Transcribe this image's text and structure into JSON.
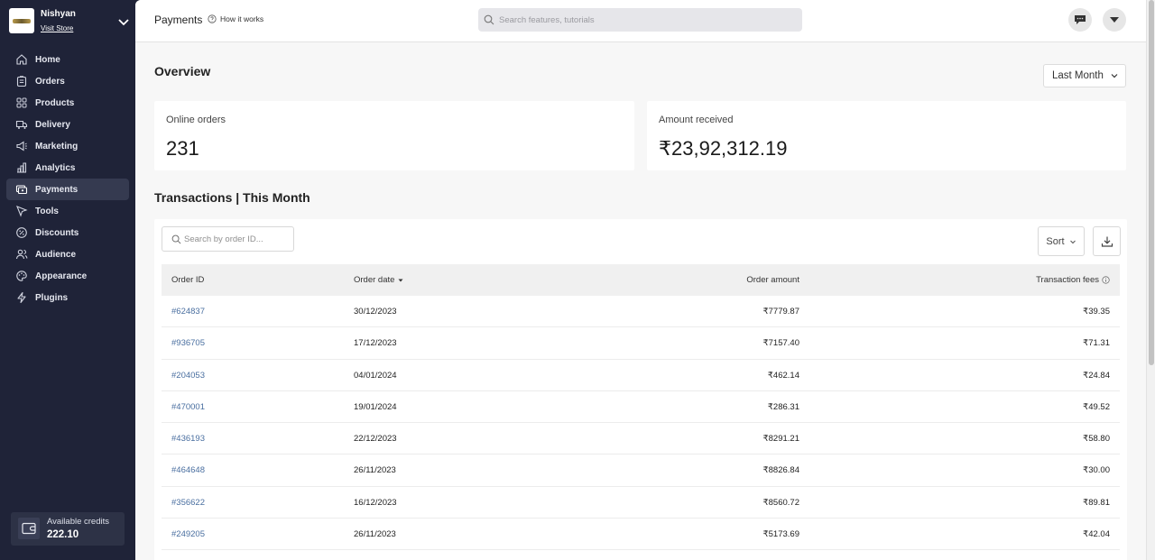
{
  "store": {
    "name": "Nishyan",
    "visit_label": "Visit Store"
  },
  "sidebar": {
    "items": [
      {
        "label": "Home",
        "icon": "home-icon"
      },
      {
        "label": "Orders",
        "icon": "clipboard-icon"
      },
      {
        "label": "Products",
        "icon": "grid-icon"
      },
      {
        "label": "Delivery",
        "icon": "truck-icon"
      },
      {
        "label": "Marketing",
        "icon": "megaphone-icon"
      },
      {
        "label": "Analytics",
        "icon": "bar-chart-icon"
      },
      {
        "label": "Payments",
        "icon": "payments-icon",
        "active": true
      },
      {
        "label": "Tools",
        "icon": "cursor-icon"
      },
      {
        "label": "Discounts",
        "icon": "discount-icon"
      },
      {
        "label": "Audience",
        "icon": "users-icon"
      },
      {
        "label": "Appearance",
        "icon": "palette-icon"
      },
      {
        "label": "Plugins",
        "icon": "lightning-icon"
      }
    ],
    "credits": {
      "label": "Available credits",
      "value": "222.10"
    }
  },
  "header": {
    "title": "Payments",
    "how_it_works": "How it works",
    "search_placeholder": "Search features, tutorials"
  },
  "overview": {
    "title": "Overview",
    "period": "Last Month",
    "cards": [
      {
        "label": "Online orders",
        "value": "231"
      },
      {
        "label": "Amount received",
        "value": "₹23,92,312.19"
      }
    ]
  },
  "transactions": {
    "title": "Transactions | This Month",
    "search_placeholder": "Search by order ID...",
    "sort_label": "Sort",
    "columns": [
      "Order ID",
      "Order date",
      "Order amount",
      "Transaction fees"
    ],
    "rows": [
      {
        "id": "#624837",
        "date": "30/12/2023",
        "amount": "₹7779.87",
        "fee": "₹39.35"
      },
      {
        "id": "#936705",
        "date": "17/12/2023",
        "amount": "₹7157.40",
        "fee": "₹71.31"
      },
      {
        "id": "#204053",
        "date": "04/01/2024",
        "amount": "₹462.14",
        "fee": "₹24.84"
      },
      {
        "id": "#470001",
        "date": "19/01/2024",
        "amount": "₹286.31",
        "fee": "₹49.52"
      },
      {
        "id": "#436193",
        "date": "22/12/2023",
        "amount": "₹8291.21",
        "fee": "₹58.80"
      },
      {
        "id": "#464648",
        "date": "26/11/2023",
        "amount": "₹8826.84",
        "fee": "₹30.00"
      },
      {
        "id": "#356622",
        "date": "16/12/2023",
        "amount": "₹8560.72",
        "fee": "₹89.81"
      },
      {
        "id": "#249205",
        "date": "26/11/2023",
        "amount": "₹5173.69",
        "fee": "₹42.04"
      }
    ]
  }
}
